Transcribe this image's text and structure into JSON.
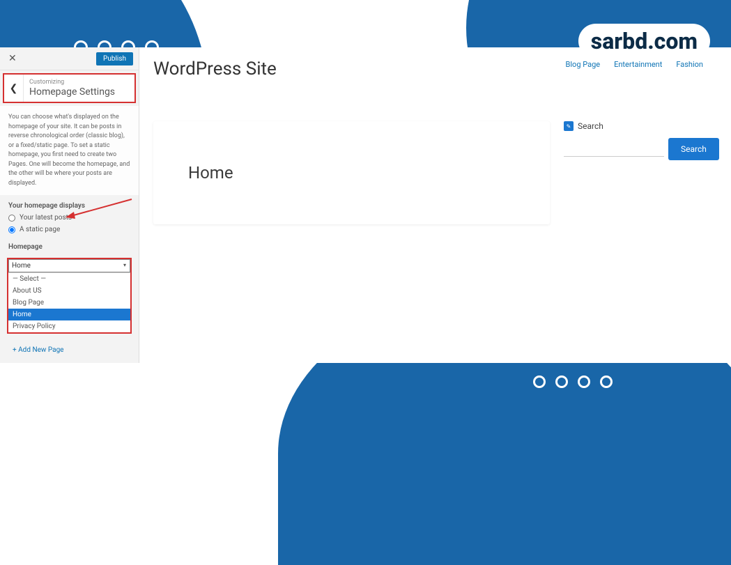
{
  "brand": "sarbd.com",
  "customizer": {
    "publish_label": "Publish",
    "breadcrumb_label": "Customizing",
    "section_title": "Homepage Settings",
    "description": "You can choose what's displayed on the homepage of your site. It can be posts in reverse chronological order (classic blog), or a fixed/static page. To set a static homepage, you first need to create two Pages. One will become the homepage, and the other will be where your posts are displayed.",
    "displays_label": "Your homepage displays",
    "option_latest": "Your latest posts",
    "option_static": "A static page",
    "homepage_label": "Homepage",
    "homepage_selected": "Home",
    "options": {
      "select": "— Select —",
      "about": "About US",
      "blog": "Blog Page",
      "home": "Home",
      "privacy": "Privacy Policy"
    },
    "add_new_label": "+ Add New Page"
  },
  "preview": {
    "site_title": "WordPress Site",
    "nav": {
      "blog": "Blog Page",
      "entertainment": "Entertainment",
      "fashion": "Fashion"
    },
    "page_title": "Home",
    "search_widget_title": "Search",
    "search_button": "Search"
  }
}
